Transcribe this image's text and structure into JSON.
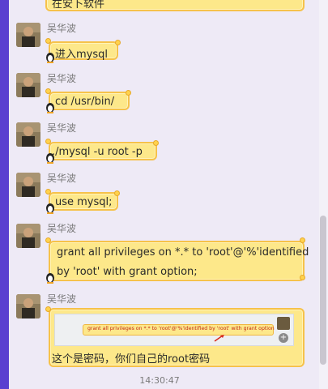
{
  "messages": [
    {
      "sender": "",
      "text": "在安卜软件"
    },
    {
      "sender": "吴华波",
      "text": "进入mysql"
    },
    {
      "sender": "吴华波",
      "text": "cd /usr/bin/"
    },
    {
      "sender": "吴华波",
      "text": "./mysql -u root -p"
    },
    {
      "sender": "吴华波",
      "text": "use mysql;"
    },
    {
      "sender": "吴华波",
      "text_line1": "grant all privileges on *.* to 'root'@'%'identified",
      "text_line2": "by 'root' with grant option;"
    },
    {
      "sender": "吴华波",
      "image_text": "grant all privileges on *.* to 'root'@'%'identified by 'root' with grant option",
      "text": "这个是密码，你们自己的root密码"
    }
  ],
  "timestamp": "14:30:47",
  "colors": {
    "bubble_fill": "#fde88a",
    "bubble_border": "#f6c24a",
    "left_accent": "#5a3fd0",
    "background": "#eeeaf6"
  },
  "icons": {
    "avatar": "user-avatar-photo",
    "mascot": "penguin-mascot-icon",
    "zoom": "zoom-in-icon",
    "arrow": "red-arrow-icon"
  }
}
